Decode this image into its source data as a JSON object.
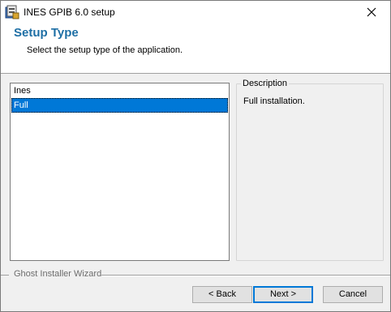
{
  "window": {
    "title": "INES GPIB 6.0 setup",
    "icon": "installer-icon",
    "close_icon": "close-icon"
  },
  "header": {
    "title": "Setup Type",
    "subtitle": "Select the setup type of the application."
  },
  "setup_list": {
    "items": [
      {
        "label": "Ines",
        "selected": false
      },
      {
        "label": "Full",
        "selected": true
      }
    ]
  },
  "description": {
    "legend": "Description",
    "text": "Full installation."
  },
  "footer": {
    "wizard_label": "Ghost Installer Wizard",
    "back_label": "< Back",
    "next_label": "Next >",
    "cancel_label": "Cancel"
  },
  "colors": {
    "accent": "#0078d7",
    "header_title": "#1e6fa5"
  }
}
